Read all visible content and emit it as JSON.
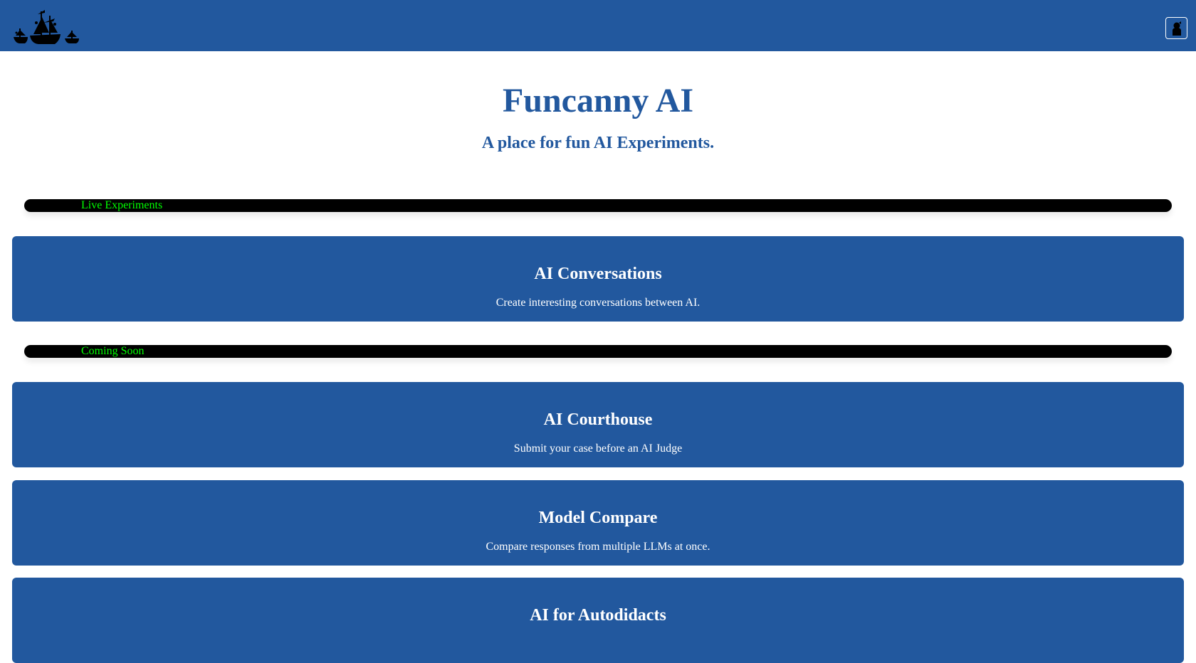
{
  "navbar": {
    "logo_icon": "pirate-ships-logo-icon",
    "user_icon": "user-silhouette-icon",
    "background": "#22589e"
  },
  "hero": {
    "title": "Funcanny AI",
    "subtitle": "A place for fun AI Experiments."
  },
  "sections": {
    "live": {
      "label": "Live Experiments"
    },
    "coming": {
      "label": "Coming Soon"
    }
  },
  "cards": {
    "conversations": {
      "title": "AI Conversations",
      "description": "Create interesting conversations between AI."
    },
    "courthouse": {
      "title": "AI Courthouse",
      "description": "Submit your case before an AI Judge"
    },
    "compare": {
      "title": "Model Compare",
      "description": "Compare responses from multiple LLMs at once."
    },
    "autodidacts": {
      "title": "AI for Autodidacts",
      "description": ""
    }
  },
  "colors": {
    "primary": "#22589e",
    "section_bar": "#000000",
    "section_label": "#00ff00",
    "card_text": "#ffffff"
  }
}
